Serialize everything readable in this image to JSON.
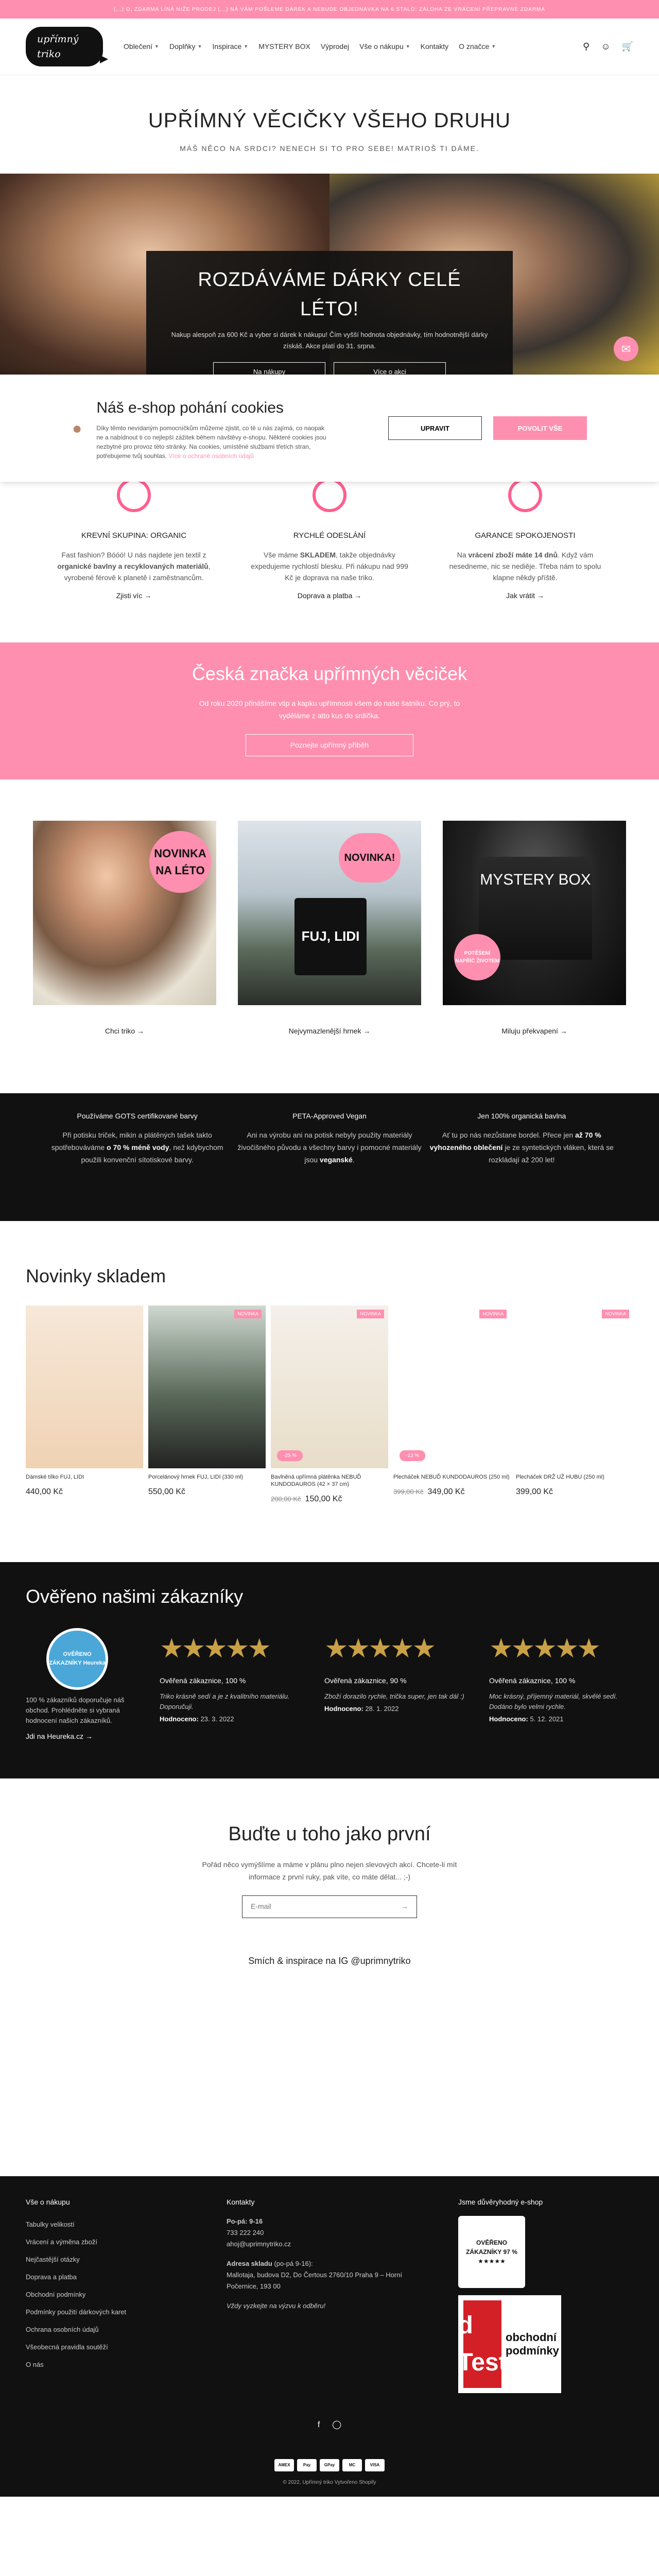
{
  "announcement": "(...) O, ZDARMA LÍNÁ NIŽE PRODEJ (...) NÁ VÁM POŠLEME DÁREK A NEBUDE OBJEDNÁVKA NA 6 STALO: ZÁLOHA ZE VRÁCENÍ PŘEPRAVNÉ ZDARMA",
  "brand": "upřímný triko",
  "nav": [
    "Oblečení",
    "Doplňky",
    "Inspirace",
    "MYSTERY BOX",
    "Výprodej",
    "Vše o nákupu",
    "Kontakty",
    "O značce"
  ],
  "nav_dropdown": [
    true,
    true,
    true,
    false,
    false,
    true,
    false,
    true
  ],
  "hero": {
    "title": "UPŘÍMNÝ VĚCIČKY VŠEHO DRUHU",
    "subtitle": "MÁŠ NĚCO NA SRDCI? NENECH SI TO PRO SEBE! MATRIOŠ TI DÁME."
  },
  "banner": {
    "title": "ROZDÁVÁME DÁRKY CELÉ LÉTO!",
    "text": "Nakup alespoň za 600 Kč a vyber si dárek k nákupu! Čím vyšší hodnota objednávky, tím hodnotnější dárky získáš. Akce platí do 31. srpna.",
    "btn1": "Na nákupy",
    "btn2": "Více o akci"
  },
  "cookie": {
    "title": "Náš e-shop pohání cookies",
    "text": "Díky těmto nevídaným pomocníčkům můžeme zjistit, co tě u nás zajímá, co naopak ne a nabídnout ti co nejlepší zážitek během návštěvy e-shopu. Některé cookies jsou nezbytné pro provoz této stránky. Na cookies, umístěné službami třetích stran, potřebujeme tvůj souhlas.",
    "link": "Více o ochraně osobních údajů",
    "btn_adjust": "UPRAVIT",
    "btn_allow": "POVOLIT VŠE"
  },
  "features": [
    {
      "title": "KREVNÍ SKUPINA: ORGANIC",
      "text_a": "Fast fashion? Bóóó! U nás najdete jen textil z ",
      "bold": "organické bavlny a recyklovaných materiálů",
      "text_b": ", vyrobené férově k planetě i zaměstnancům.",
      "link": "Zjisti víc"
    },
    {
      "title": "RYCHLÉ ODESLÁNÍ",
      "text_a": "Vše máme ",
      "bold": "SKLADEM",
      "text_b": ", takže objednávky expedujeme rychlostí blesku. Při nákupu nad 999 Kč je doprava na naše triko.",
      "link": "Doprava a platba"
    },
    {
      "title": "GARANCE SPOKOJENOSTI",
      "text_a": "Na ",
      "bold": "vrácení zboží máte 14 dnů",
      "text_b": ". Když vám nesedneme, nic se nediěje. Třeba nám to spolu klapne někdy příště.",
      "link": "Jak vrátit"
    }
  ],
  "pinkband": {
    "title": "Česká značka upřímných věciček",
    "text": "Od roku 2020 přinášíme vtip a kapku upřímnosti všem do naše šatníku. Co prý, to vyděláme z atto kus do srdíčka.",
    "btn": "Poznejte upřímný příběh"
  },
  "collections": [
    {
      "badge": "NOVINKA NA LÉTO",
      "link": "Chci triko"
    },
    {
      "badge": "NOVINKA!",
      "mug": "FUJ, LIDI",
      "link": "Nejvymazlenější hrnek"
    },
    {
      "badge": "POTĚŠENÍ NAPŘÍČ ŽIVOTEM",
      "box": "MYSTERY BOX",
      "link": "Miluju překvapení"
    }
  ],
  "blackband": [
    {
      "title": "Používáme GOTS certifikované barvy",
      "text_a": "Při potisku triček, mikin a plátěných tašek takto spotřebováváme ",
      "bold": "o 70 % méně vody",
      "text_b": ", než kdybychom použili konvenční sítotiskové barvy."
    },
    {
      "title": "PETA-Approved Vegan",
      "text_a": "Ani na výrobu ani na potisk nebyly použity materiály živočišného původu a všechny barvy i pomocné materiály jsou ",
      "bold": "veganské",
      "text_b": "."
    },
    {
      "title": "Jen 100% organická bavlna",
      "text_a": "Ať tu po nás nezůstane bordel. Přece jen ",
      "bold": "až 70 % vyhozeného oblečení",
      "text_b": " je ze syntetických vláken, která se rozkládají až 200 let!"
    }
  ],
  "new_products": {
    "title": "Novinky skladem",
    "items": [
      {
        "tag": "",
        "name": "Dámské tílko FUJ, LIDI",
        "old": "",
        "price": "440,00 Kč",
        "sale": ""
      },
      {
        "tag": "NOVINKA",
        "name": "Porcelánový hrnek FUJ, LIDI (330 ml)",
        "old": "",
        "price": "550,00 Kč",
        "sale": ""
      },
      {
        "tag": "NOVINKA",
        "name": "Bavlněná upřímná plátěnka NEBUĎ KUNDODAUROS (42 × 37 cm)",
        "old": "200,00 Kč",
        "price": "150,00 Kč",
        "sale": "-25 %"
      },
      {
        "tag": "NOVINKA",
        "name": "Plecháček NEBUĎ KUNDODAUROS (250 ml)",
        "old": "399,00 Kč",
        "price": "349,00 Kč",
        "sale": "-13 %"
      },
      {
        "tag": "NOVINKA",
        "name": "Plecháček DRŽ UŽ HUBU (250 ml)",
        "old": "",
        "price": "399,00 Kč",
        "sale": ""
      }
    ]
  },
  "reviews": {
    "title": "Ověřeno našimi zákazníky",
    "heureka_badge": "OVĚŘENO ZÁKAZNÍKY Heureka",
    "heureka_text": "100 % zákazníků doporučuje náš obchod. Prohlédněte si vybraná hodnocení našich zákazníků.",
    "heureka_link": "Jdi na Heureka.cz",
    "items": [
      {
        "title": "Ověřená zákaznice, 100 %",
        "text": "Triko krásně sedí a je z kvalitního materiálu. Doporučuji.",
        "label": "Hodnoceno:",
        "date": "23. 3. 2022"
      },
      {
        "title": "Ověřená zákaznice, 90 %",
        "text": "Zboží dorazilo rychle, trička super, jen tak dál :)",
        "label": "Hodnoceno:",
        "date": "28. 1. 2022"
      },
      {
        "title": "Ověřená zákaznice, 100 %",
        "text": "Moc krásný, příjemný materiál, skvělé sedí. Dodáno bylo velmi rychle.",
        "label": "Hodnoceno:",
        "date": "5. 12. 2021"
      }
    ]
  },
  "newsletter": {
    "title": "Buďte u toho jako první",
    "text": "Pořád něco vymýšlíme a máme v plánu plno nejen slevových akcí. Chcete-li mít informace z první ruky, pak víte, co máte dělat... ;-)",
    "placeholder": "E-mail"
  },
  "instagram": "Smích & inspirace na IG @uprimnytriko",
  "footer": {
    "col1_title": "Vše o nákupu",
    "col1_links": [
      "Tabulky velikostí",
      "Vrácení a výměna zboží",
      "Nejčastější otázky",
      "Doprava a platba",
      "Obchodní podmínky",
      "Podmínky použití dárkových karet",
      "Ochrana osobních údajů",
      "Všeobecná pravidla soutěží",
      "O nás"
    ],
    "col2_title": "Kontakty",
    "hours": "Po-pá: 9-16",
    "phone": "733 222 240",
    "email": "ahoj@uprimnytriko.cz",
    "address_label": "Adresa skladu",
    "address_hours": " (po-pá 9-16):",
    "address": "Mallotaja, budova D2, Do Čertous 2760/10 Praha 9 – Horní Počernice, 193 00",
    "challenge": "Vždy vyzkejte na výzvu k odběru!",
    "col3_title": "Jsme důvěryhodný e-shop",
    "heureka_box": "OVĚŘENO ZÁKAZNÍKY 97 % ★★★★★",
    "dtest_logo": "d Test",
    "dtest_text": "obchodní podmínky",
    "payments": [
      "AMEX",
      "Pay",
      "GPay",
      "MC",
      "VISA"
    ],
    "copyright": "© 2022, Upřímný triko Vytvořeno Shopify"
  }
}
